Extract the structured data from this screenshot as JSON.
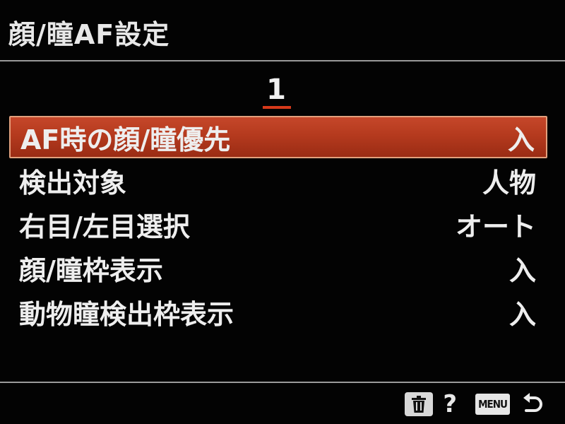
{
  "screen": {
    "title": "顔/瞳AF設定",
    "page": "1"
  },
  "menu": {
    "items": [
      {
        "label": "AF時の顔/瞳優先",
        "value": "入",
        "selected": true
      },
      {
        "label": "検出対象",
        "value": "人物",
        "selected": false
      },
      {
        "label": "右目/左目選択",
        "value": "オート",
        "selected": false
      },
      {
        "label": "顔/瞳枠表示",
        "value": "入",
        "selected": false
      },
      {
        "label": "動物瞳検出枠表示",
        "value": "入",
        "selected": false
      }
    ]
  },
  "footer": {
    "help_label": "?",
    "menu_key_label": "MENU",
    "icons": [
      "trash-icon",
      "help-icon",
      "menu-key",
      "back-icon"
    ]
  },
  "colors": {
    "background": "#030303",
    "accent": "#c5472a",
    "accent_border": "#e2a07d",
    "page_underline": "#d6391a",
    "text": "#eeeeee",
    "divider": "#9a9a9a"
  }
}
